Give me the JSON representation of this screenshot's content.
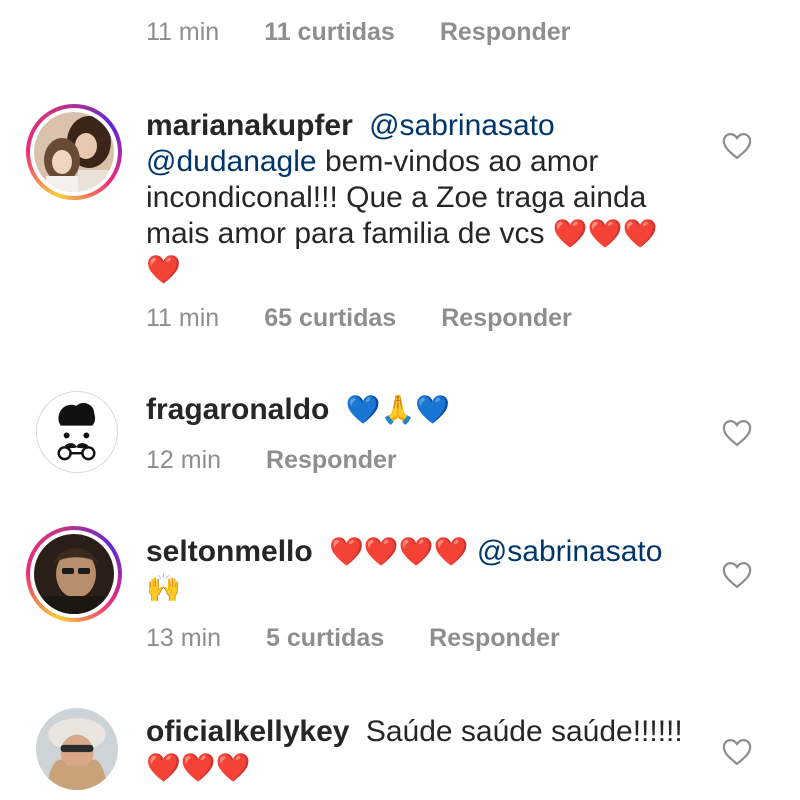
{
  "top_meta": {
    "time": "11 min",
    "likes": "11 curtidas",
    "reply": "Responder"
  },
  "comments": [
    {
      "username": "marianakupfer",
      "mention1": "@sabrinasato",
      "mention2": "@dudanagle",
      "text": "bem-vindos ao amor incondiconal!!! Que a Zoe traga ainda mais amor para familia de vcs",
      "emojis_inline": "❤️❤️❤️",
      "emojis_line": "❤️",
      "time": "11 min",
      "likes": "65 curtidas",
      "reply": "Responder",
      "avatar": "profile-photo"
    },
    {
      "username": "fragaronaldo",
      "emojis": "💙🙏💙",
      "time": "12 min",
      "reply": "Responder",
      "avatar": "mustache-glasses-icon"
    },
    {
      "username": "seltonmello",
      "emojis": "❤️❤️❤️❤️",
      "mention": "@sabrinasato",
      "emojis_line": "🙌",
      "time": "13 min",
      "likes": "5 curtidas",
      "reply": "Responder",
      "avatar": "profile-photo"
    },
    {
      "username": "oficialkellykey",
      "text": "Saúde saúde saúde!!!!!!",
      "emojis_line": "❤️❤️❤️",
      "avatar": "profile-photo"
    }
  ],
  "colors": {
    "text": "#262626",
    "meta": "#8e8e8e",
    "mention": "#003569",
    "heart_outline": "#8e8e8e"
  },
  "icons": {
    "like": "heart-outline-icon"
  }
}
